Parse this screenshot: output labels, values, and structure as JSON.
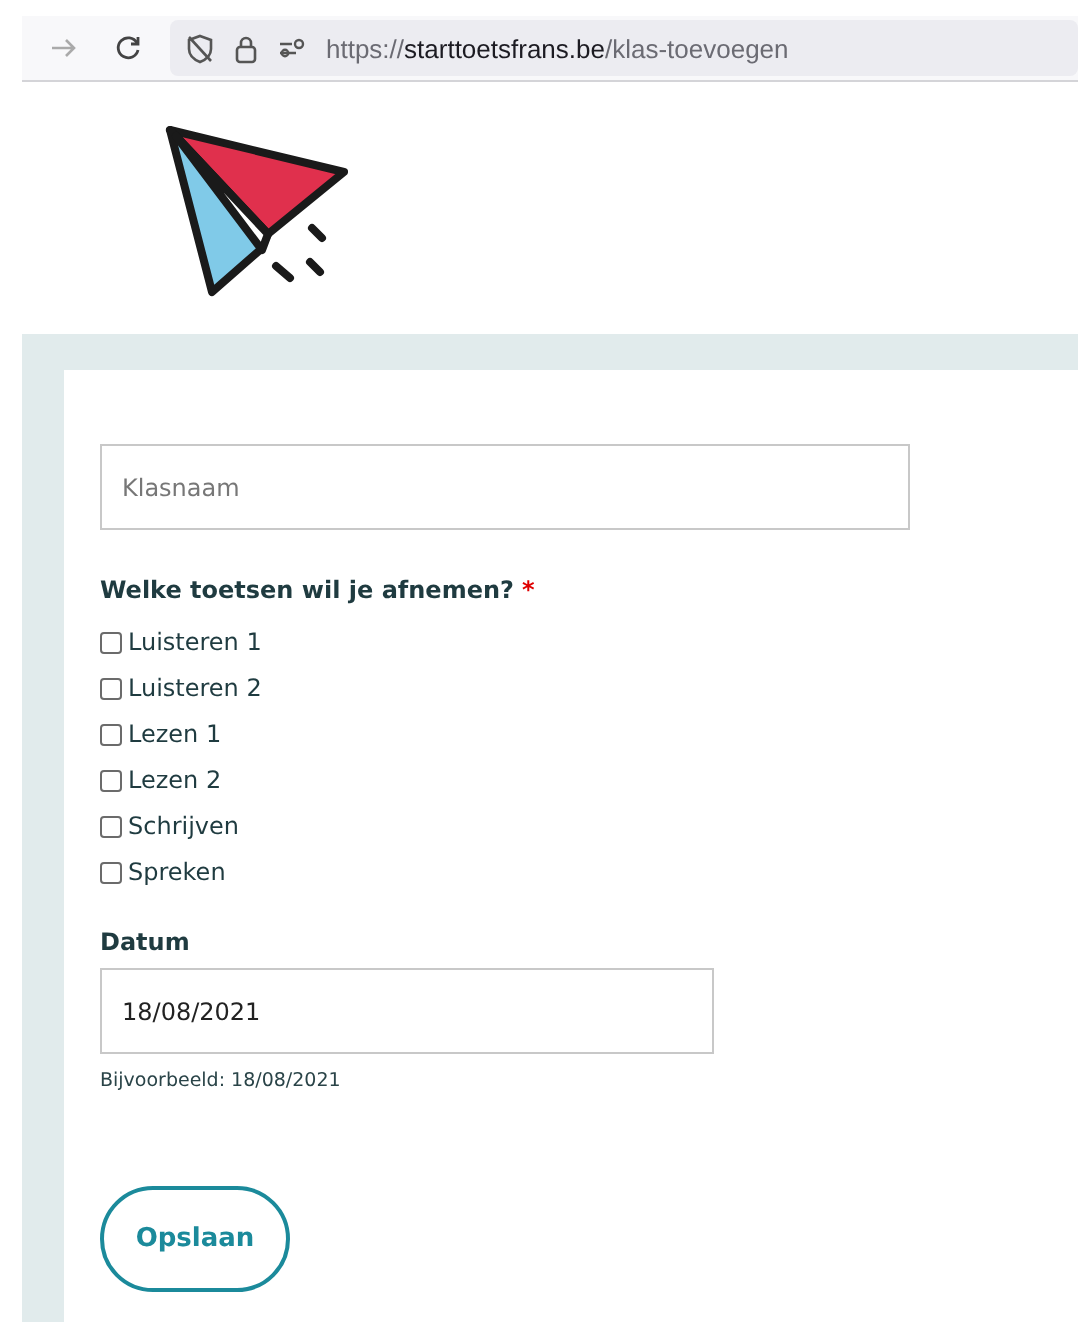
{
  "browser": {
    "address": {
      "scheme": "https://",
      "host": "starttoetsfrans.be",
      "path": "/klas-toevoegen"
    }
  },
  "form": {
    "name_field": {
      "placeholder": "Klasnaam"
    },
    "tests_label": "Welke toetsen wil je afnemen?",
    "required_mark": "*",
    "tests": [
      {
        "label": "Luisteren 1",
        "checked": false
      },
      {
        "label": "Luisteren 2",
        "checked": false
      },
      {
        "label": "Lezen 1",
        "checked": false
      },
      {
        "label": "Lezen 2",
        "checked": false
      },
      {
        "label": "Schrijven",
        "checked": false
      },
      {
        "label": "Spreken",
        "checked": false
      }
    ],
    "date_label": "Datum",
    "date_field": {
      "value": "18/08/2021"
    },
    "date_hint": "Bijvoorbeeld: 18/08/2021",
    "save_button": "Opslaan"
  }
}
